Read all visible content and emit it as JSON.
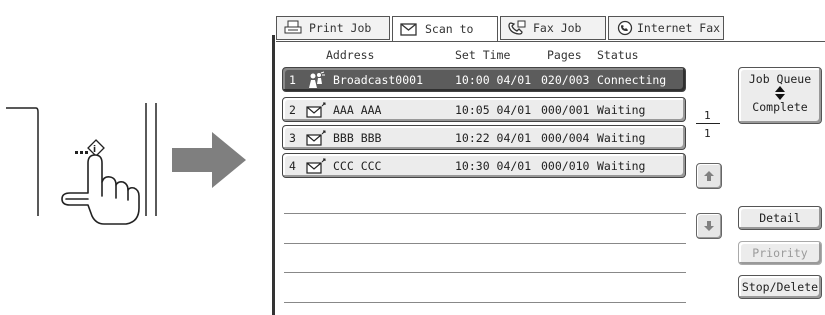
{
  "tabs": [
    {
      "label": "Print Job",
      "icon": "printer-icon",
      "active": false
    },
    {
      "label": "Scan to",
      "icon": "scan-envelope-icon",
      "active": true
    },
    {
      "label": "Fax Job",
      "icon": "fax-phone-icon",
      "active": false
    },
    {
      "label": "Internet Fax",
      "icon": "internet-fax-icon",
      "active": false
    }
  ],
  "columns": {
    "address": "Address",
    "set_time": "Set Time",
    "pages": "Pages",
    "status": "Status"
  },
  "jobs": [
    {
      "num": "1",
      "icon": "broadcast-icon",
      "address": "Broadcast0001",
      "time": "10:00 04/01",
      "pages": "020/003",
      "status": "Connecting",
      "selected": true
    },
    {
      "num": "2",
      "icon": "envelope-icon",
      "address": "AAA AAA",
      "time": "10:05 04/01",
      "pages": "000/001",
      "status": "Waiting",
      "selected": false
    },
    {
      "num": "3",
      "icon": "envelope-icon",
      "address": "BBB BBB",
      "time": "10:22 04/01",
      "pages": "000/004",
      "status": "Waiting",
      "selected": false
    },
    {
      "num": "4",
      "icon": "envelope-icon",
      "address": "CCC CCC",
      "time": "10:30 04/01",
      "pages": "000/010",
      "status": "Waiting",
      "selected": false
    }
  ],
  "pager": {
    "current": "1",
    "total": "1"
  },
  "buttons": {
    "job_queue": "Job Queue",
    "complete": "Complete",
    "detail": "Detail",
    "priority": "Priority",
    "stop_delete": "Stop/Delete"
  },
  "colors": {
    "selected_row": "#5c5c5c",
    "arrow": "#808080"
  }
}
